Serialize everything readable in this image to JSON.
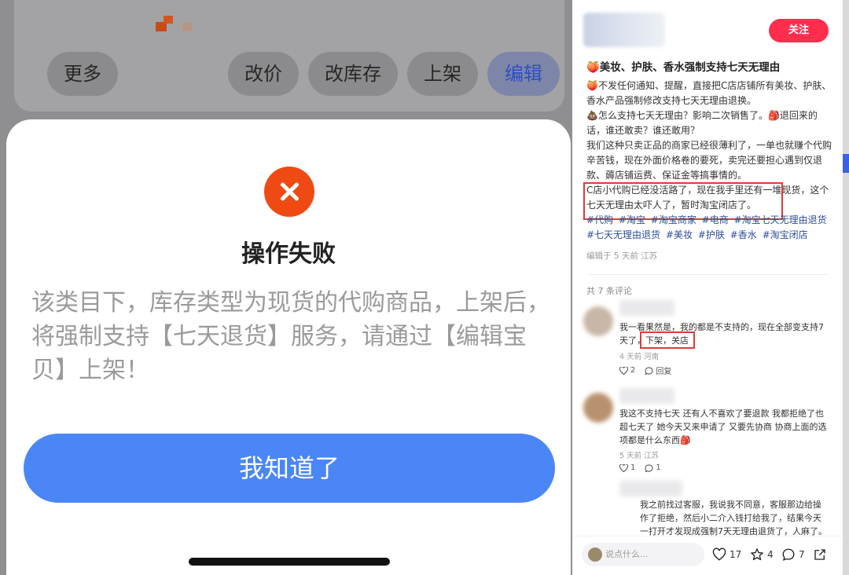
{
  "phone": {
    "toolbar": {
      "more": "更多",
      "reprice": "改价",
      "restock": "改库存",
      "shelve": "上架",
      "edit": "编辑"
    },
    "dialog": {
      "title": "操作失败",
      "message": "该类目下，库存类型为现货的代购商品，上架后，将强制支持【七天退货】服务，请通过【编辑宝贝】上架！",
      "confirm": "我知道了"
    }
  },
  "post": {
    "follow": "关注",
    "title": "🍑美妆、护肤、香水强制支持七天无理由",
    "body": [
      "🍑不发任何通知、提醒，直接把C店店铺所有美妆、护肤、香水产品强制修改支持七天无理由退换。",
      "💩怎么支持七天无理由？影响二次销售了。🎒退回来的话，谁还敢卖？谁还敢用？",
      "我们这种只卖正品的商家已经很薄利了，一单也就赚个代购辛苦钱，现在外面价格卷的要死，卖完还要担心遇到仅退款、薅店铺运费、保证金等搞事情的。",
      "C店小代购已经没活路了，现在我手里还有一堆现货，这个七天无理由太吓人了，暂时淘宝闭店了。"
    ],
    "tags": [
      "#代购",
      "#淘宝",
      "#淘宝商家",
      "#电商",
      "#淘宝七天无理由退货",
      "#七天无理由退货",
      "#美妆",
      "#护肤",
      "#香水",
      "#淘宝闭店"
    ],
    "meta": "编辑于 5 天前 江苏",
    "comment_count": "共 7 条评论",
    "comments": [
      {
        "text": "我一看果然是，我的都是不支持的，现在全部变支持7天了，下架，关店",
        "meta": "4 天前 河南",
        "likes": "2",
        "reply": "回复"
      },
      {
        "text": "我这不支持七天 还有人不喜欢了要退款 我都拒绝了也超七天了 她今天又来申请了 又要先协商 协商上面的选项都是什么东西🎒",
        "meta": "5 天前 江苏",
        "likes": "1",
        "reply": "1"
      },
      {
        "text": "我之前找过客服，我说我不同意，客服那边给操作了拒绝，然后小二介入钱打给我了，结果今天一打开才发现成强制7天无理由退货了，人麻了。"
      }
    ],
    "bottom": {
      "placeholder": "说点什么...",
      "likes": "17",
      "stars": "4",
      "comments": "7"
    }
  }
}
